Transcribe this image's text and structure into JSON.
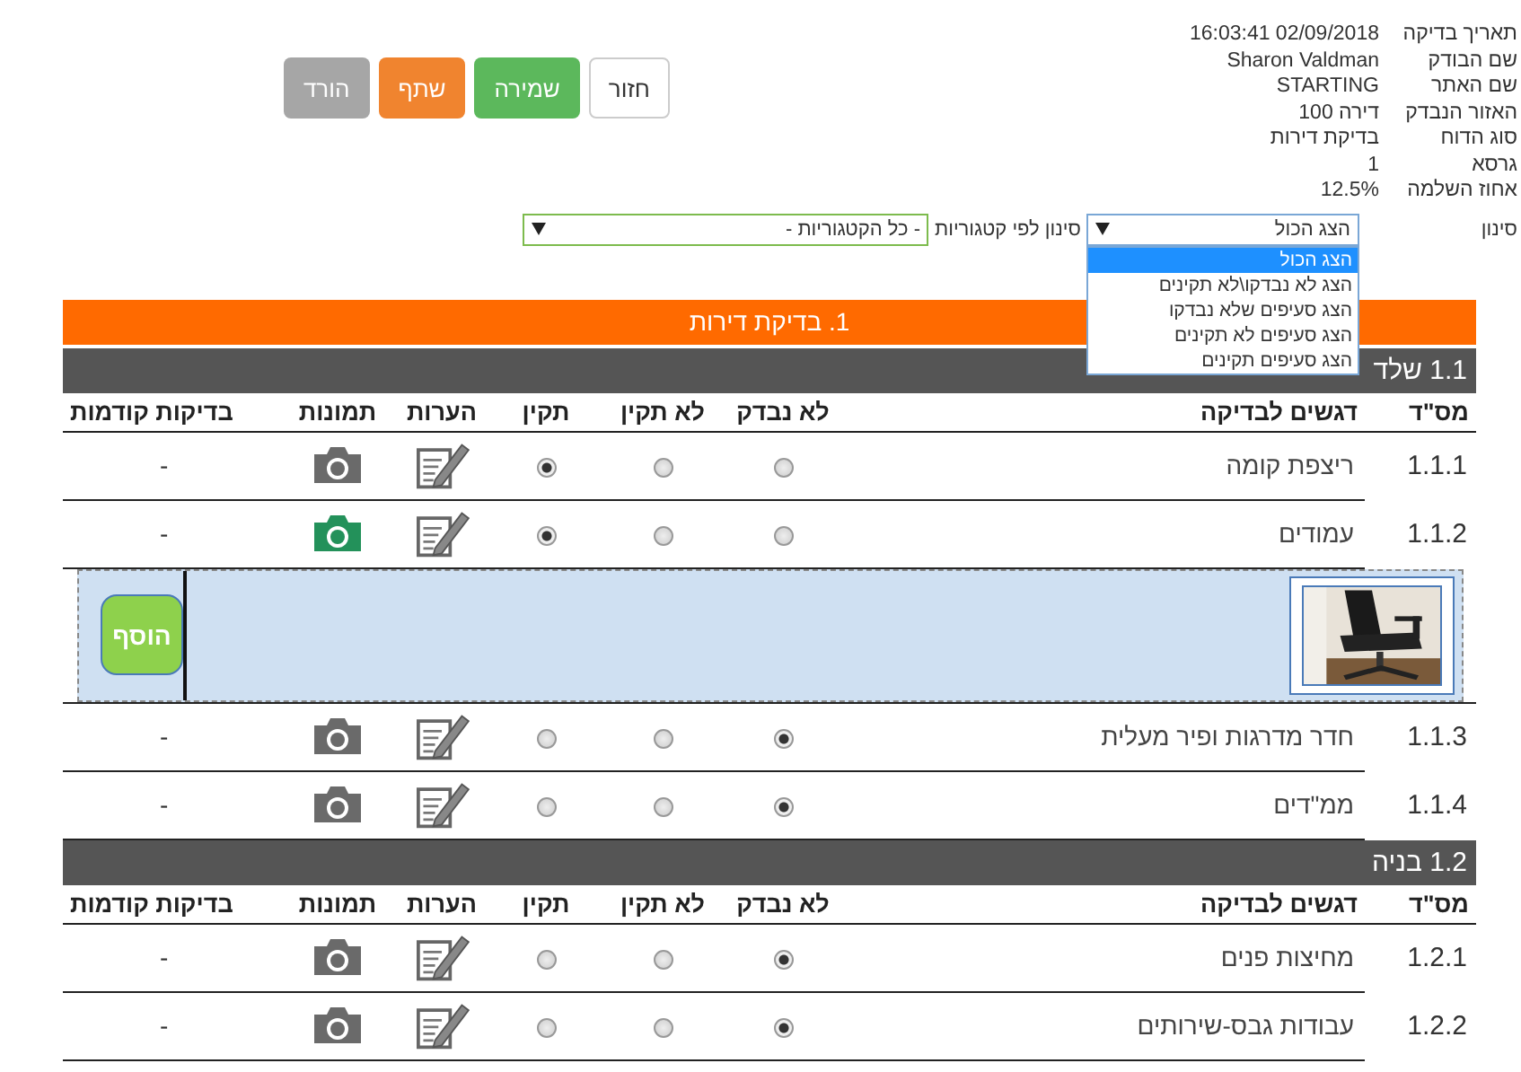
{
  "buttons": [
    {
      "kind": "default",
      "label": "חזור"
    },
    {
      "kind": "success",
      "label": "שמירה"
    },
    {
      "kind": "warning",
      "label": "שתף"
    },
    {
      "kind": "muted",
      "label": "הורד"
    }
  ],
  "info": [
    {
      "label": "תאריך בדיקה",
      "value": "16:03:41 02/09/2018"
    },
    {
      "label": "שם הבודק",
      "value": "Sharon Valdman"
    },
    {
      "label": "שם האתר",
      "value": "STARTING"
    },
    {
      "label": "האזור הנבדק",
      "value": "דירה 100"
    },
    {
      "label": "סוג הדוח",
      "value": "בדיקת דירות"
    },
    {
      "label": "גרסא",
      "value": "1"
    },
    {
      "label": "אחוז השלמה",
      "value": "12.5%"
    }
  ],
  "filter": {
    "label": "סינון",
    "select": {
      "value": "הצג הכול",
      "options": [
        {
          "label": "הצג הכול",
          "selected": true
        },
        {
          "label": "הצג לא נבדקו\\לא תקינים",
          "selected": false
        },
        {
          "label": "הצג סעיפים שלא נבדקו",
          "selected": false
        },
        {
          "label": "הצג סעיפים לא תקינים",
          "selected": false
        },
        {
          "label": "הצג סעיפים תקינים",
          "selected": false
        }
      ]
    },
    "category_label": "סינון לפי קטגוריות",
    "category_select": {
      "value": "- כל הקטגוריות -"
    }
  },
  "report": {
    "title": "1. בדיקת דירות",
    "sections": [
      {
        "title": "1.1 שלד",
        "columns": [
          "מס\"ד",
          "דגשים לבדיקה",
          "לא נבדק",
          "לא תקין",
          "תקין",
          "הערות",
          "תמונות",
          "בדיקות קודמות"
        ],
        "rows": [
          {
            "number": "1.1.1",
            "item": "ריצפת קומה",
            "not_checked": false,
            "not_ok": false,
            "ok": true,
            "has_photos": false,
            "previous": "-",
            "expanded": false
          },
          {
            "number": "1.1.2",
            "item": "עמודים",
            "not_checked": false,
            "not_ok": false,
            "ok": true,
            "has_photos": true,
            "previous": "-",
            "expanded": true,
            "add_button": "הוסף"
          },
          {
            "number": "1.1.3",
            "item": "חדר מדרגות ופיר מעלית",
            "not_checked": true,
            "not_ok": false,
            "ok": false,
            "has_photos": false,
            "previous": "-",
            "expanded": false
          },
          {
            "number": "1.1.4",
            "item": "ממ\"דים",
            "not_checked": true,
            "not_ok": false,
            "ok": false,
            "has_photos": false,
            "previous": "-",
            "expanded": false
          }
        ]
      },
      {
        "title": "1.2 בניה",
        "columns": [
          "מס\"ד",
          "דגשים לבדיקה",
          "לא נבדק",
          "לא תקין",
          "תקין",
          "הערות",
          "תמונות",
          "בדיקות קודמות"
        ],
        "rows": [
          {
            "number": "1.2.1",
            "item": "מחיצות פנים",
            "not_checked": true,
            "not_ok": false,
            "ok": false,
            "has_photos": false,
            "previous": "-",
            "expanded": false
          },
          {
            "number": "1.2.2",
            "item": "עבודות גבס-שירותים",
            "not_checked": true,
            "not_ok": false,
            "ok": false,
            "has_photos": false,
            "previous": "-",
            "expanded": false
          }
        ]
      }
    ]
  }
}
